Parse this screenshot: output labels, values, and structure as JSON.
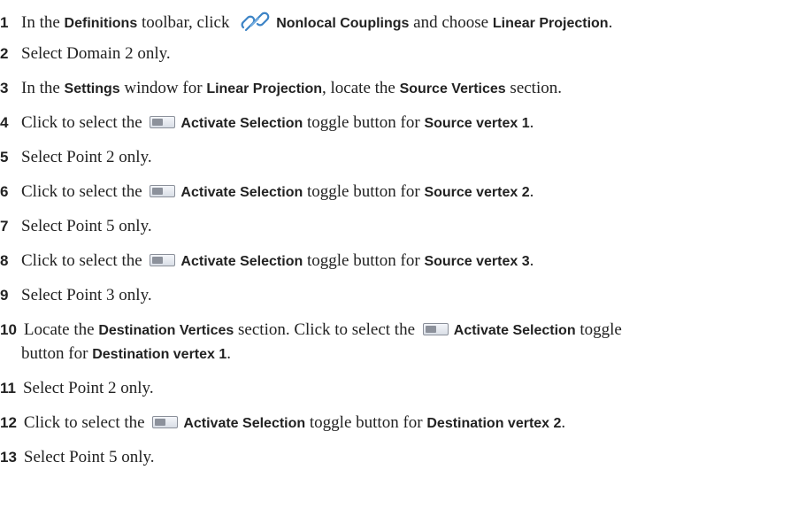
{
  "steps": [
    {
      "num": "1",
      "t1": "In the ",
      "b1": "Definitions",
      "t2": " toolbar, click ",
      "b2": "Nonlocal Couplings",
      "t3": " and choose ",
      "b3": "Linear Projection",
      "t4": "."
    },
    {
      "num": "2",
      "t1": "Select Domain 2 only."
    },
    {
      "num": "3",
      "t1": "In the ",
      "b1": "Settings",
      "t2": " window for ",
      "b2": "Linear Projection",
      "t3": ", locate the ",
      "b3": "Source Vertices",
      "t4": " section."
    },
    {
      "num": "4",
      "t1": "Click to select the ",
      "b1": "Activate Selection",
      "t2": " toggle button for ",
      "b2": "Source vertex 1",
      "t3": "."
    },
    {
      "num": "5",
      "t1": "Select Point 2 only."
    },
    {
      "num": "6",
      "t1": "Click to select the ",
      "b1": "Activate Selection",
      "t2": " toggle button for ",
      "b2": "Source vertex 2",
      "t3": "."
    },
    {
      "num": "7",
      "t1": "Select Point 5 only."
    },
    {
      "num": "8",
      "t1": "Click to select the ",
      "b1": "Activate Selection",
      "t2": " toggle button for ",
      "b2": "Source vertex 3",
      "t3": "."
    },
    {
      "num": "9",
      "t1": "Select Point 3 only."
    },
    {
      "num": "10",
      "t1": "Locate the ",
      "b1": "Destination Vertices",
      "t2": " section. Click to select the ",
      "b2": "Activate Selection",
      "t3": " toggle",
      "t4": "button for ",
      "b3": "Destination vertex 1",
      "t5": "."
    },
    {
      "num": "11",
      "t1": "Select Point 2 only."
    },
    {
      "num": "12",
      "t1": "Click to select the ",
      "b1": "Activate Selection",
      "t2": " toggle button for ",
      "b2": "Destination vertex 2",
      "t3": "."
    },
    {
      "num": "13",
      "t1": "Select Point 5 only."
    }
  ],
  "icons": {
    "nonlocal": "link-chain-icon",
    "toggle": "activate-selection-toggle-icon"
  }
}
